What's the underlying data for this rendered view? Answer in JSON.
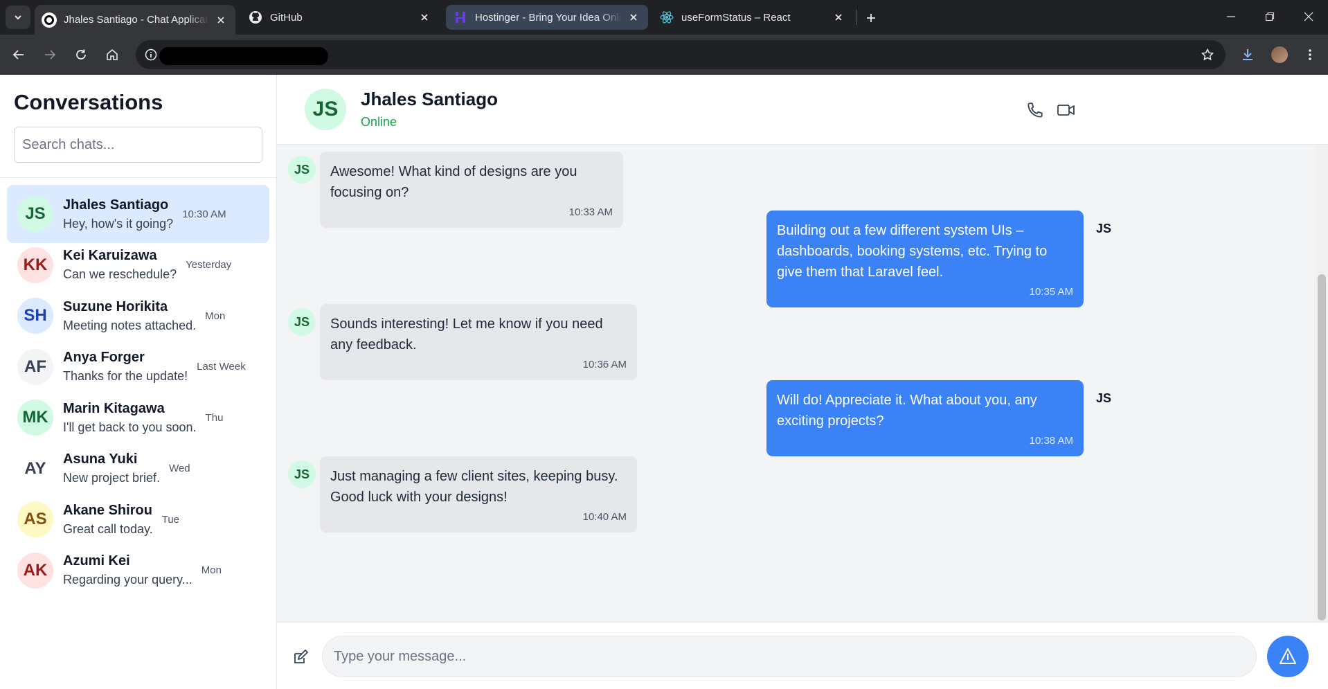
{
  "browser": {
    "tabs": [
      {
        "title": "Jhales Santiago - Chat Application",
        "icon": "app-favicon"
      },
      {
        "title": "GitHub",
        "icon": "github-icon"
      },
      {
        "title": "Hostinger - Bring Your Idea Online",
        "icon": "hostinger-icon"
      },
      {
        "title": "useFormStatus – React",
        "icon": "react-icon"
      }
    ],
    "address": ""
  },
  "sidebar": {
    "title": "Conversations",
    "search_placeholder": "Search chats...",
    "conversations": [
      {
        "initials": "JS",
        "name": "Jhales Santiago",
        "preview": "Hey, how's it going?",
        "time": "10:30 AM",
        "bg": "#d1fae5",
        "fg": "#166534",
        "active": true
      },
      {
        "initials": "KK",
        "name": "Kei Karuizawa",
        "preview": "Can we reschedule?",
        "time": "Yesterday",
        "bg": "#fee2e2",
        "fg": "#991b1b"
      },
      {
        "initials": "SH",
        "name": "Suzune Horikita",
        "preview": "Meeting notes attached.",
        "time": "Mon",
        "bg": "#dbeafe",
        "fg": "#1e40af"
      },
      {
        "initials": "AF",
        "name": "Anya Forger",
        "preview": "Thanks for the update!",
        "time": "Last Week",
        "bg": "#f3f4f6",
        "fg": "#374151"
      },
      {
        "initials": "MK",
        "name": "Marin Kitagawa",
        "preview": "I'll get back to you soon.",
        "time": "Thu",
        "bg": "#d1fae5",
        "fg": "#166534"
      },
      {
        "initials": "AY",
        "name": "Asuna Yuki",
        "preview": "New project brief.",
        "time": "Wed",
        "bg": "#ffffff",
        "fg": "#374151"
      },
      {
        "initials": "AS",
        "name": "Akane Shirou",
        "preview": "Great call today.",
        "time": "Tue",
        "bg": "#fef9c3",
        "fg": "#854d0e"
      },
      {
        "initials": "AK",
        "name": "Azumi Kei",
        "preview": "Regarding your query...",
        "time": "Mon",
        "bg": "#fee2e2",
        "fg": "#991b1b"
      }
    ]
  },
  "chat": {
    "contact": {
      "initials": "JS",
      "name": "Jhales Santiago",
      "status": "Online"
    },
    "messages": [
      {
        "from": "them",
        "avatar": "JS",
        "text": "Awesome! What kind of designs are you focusing on?",
        "time": "10:33 AM"
      },
      {
        "from": "me",
        "avatar": "JS",
        "text": "Building out a few different system UIs – dashboards, booking systems, etc. Trying to give them that Laravel feel.",
        "time": "10:35 AM"
      },
      {
        "from": "them",
        "avatar": "JS",
        "text": "Sounds interesting! Let me know if you need any feedback.",
        "time": "10:36 AM"
      },
      {
        "from": "me",
        "avatar": "JS",
        "text": "Will do! Appreciate it. What about you, any exciting projects?",
        "time": "10:38 AM"
      },
      {
        "from": "them",
        "avatar": "JS",
        "text": "Just managing a few client sites, keeping busy. Good luck with your designs!",
        "time": "10:40 AM"
      }
    ],
    "composer_placeholder": "Type your message..."
  },
  "colors": {
    "accent": "#3b82f6",
    "online": "#16a34a",
    "active_row": "#dbeafe"
  }
}
